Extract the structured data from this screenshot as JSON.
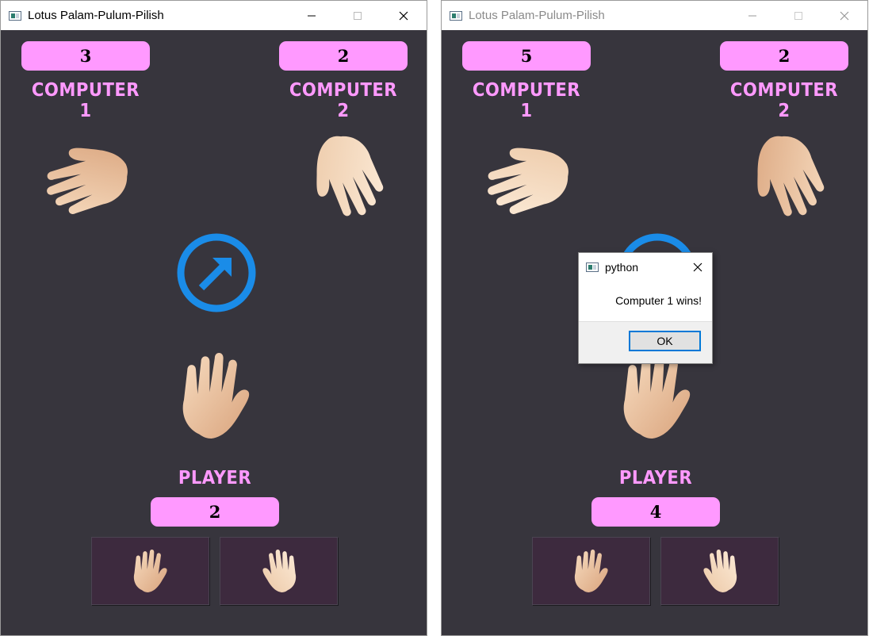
{
  "windows": [
    {
      "title": "Lotus Palam-Pulum-Pilish",
      "active": true,
      "computer1_score": "3",
      "computer1_label": "COMPUTER 1",
      "computer2_score": "2",
      "computer2_label": "COMPUTER 2",
      "player_label": "PLAYER",
      "player_score": "2",
      "center_icon": "arrow-up-right-circle-icon"
    },
    {
      "title": "Lotus Palam-Pulum-Pilish",
      "active": false,
      "computer1_score": "5",
      "computer1_label": "COMPUTER 1",
      "computer2_score": "2",
      "computer2_label": "COMPUTER 2",
      "player_label": "PLAYER",
      "player_score": "4",
      "center_icon": "arrow-up-right-circle-icon"
    }
  ],
  "dialog": {
    "title": "python",
    "message": "Computer 1 wins!",
    "ok_label": "OK"
  },
  "colors": {
    "background": "#37353d",
    "accent_pink": "#ff99ff",
    "ring_blue": "#1a8ce8",
    "button_bg": "#3d2a3e"
  },
  "icons": {
    "choice_buttons": [
      "palm-up-hand-icon",
      "palm-down-hand-icon"
    ]
  }
}
